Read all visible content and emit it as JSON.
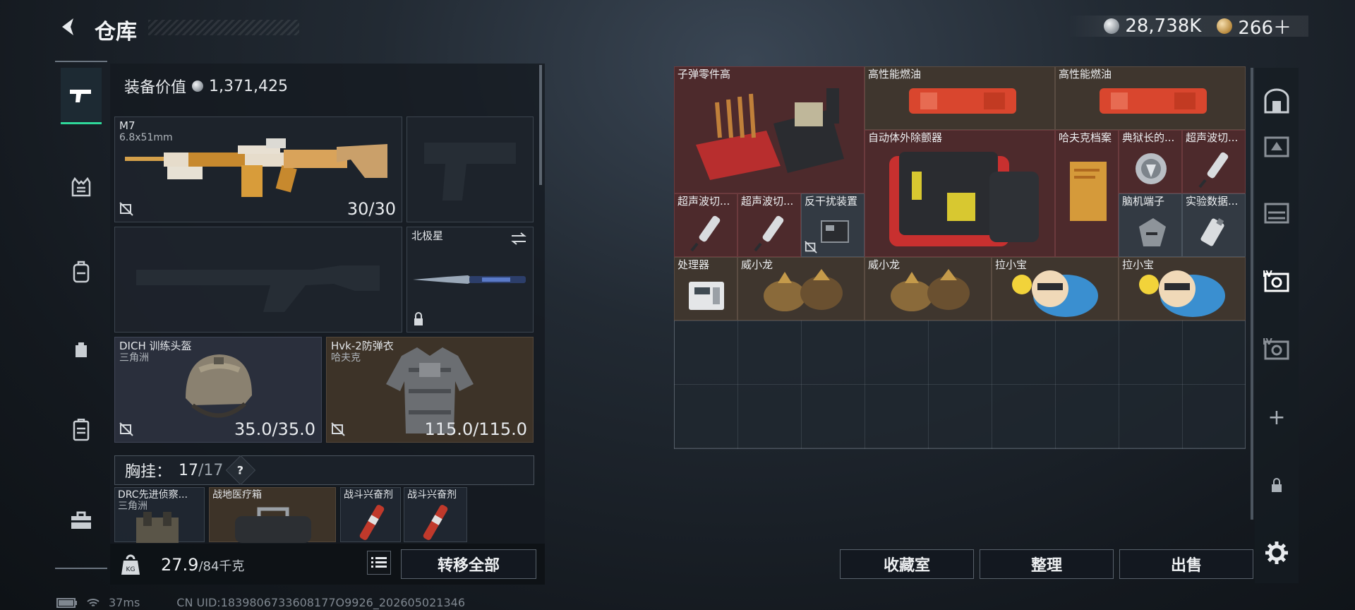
{
  "header": {
    "title": "仓库",
    "silver_amount": "28,738K",
    "gold_amount": "266＋"
  },
  "loadout": {
    "equip_value_label": "装备价值",
    "equip_value": "1,371,425",
    "primary": {
      "name": "M7",
      "caliber": "6.8x51mm",
      "ammo": "30/30"
    },
    "melee": {
      "name": "北极星"
    },
    "helmet": {
      "name": "DICH 训练头盔",
      "origin": "三角洲",
      "durability": "35.0/35.0"
    },
    "armor": {
      "name": "Hvk-2防弹衣",
      "origin": "哈夫克",
      "durability": "115.0/115.0"
    },
    "chest_rig": {
      "label": "胸挂：",
      "current": "17",
      "max": "/17",
      "help": "?"
    },
    "rig_items": [
      {
        "name": "DRC先进侦察...",
        "sub": "三角洲"
      },
      {
        "name": "战地医疗箱",
        "sub": ""
      },
      {
        "name": "战斗兴奋剂",
        "sub": ""
      },
      {
        "name": "战斗兴奋剂",
        "sub": ""
      }
    ],
    "weight": "27.9",
    "weight_max": "/84千克",
    "transfer_all": "转移全部"
  },
  "storage": {
    "items": [
      {
        "name": "子弹零件高",
        "color": "red"
      },
      {
        "name": "高性能燃油",
        "color": "tan"
      },
      {
        "name": "高性能燃油",
        "color": "tan"
      },
      {
        "name": "自动体外除颤器",
        "color": "red"
      },
      {
        "name": "哈夫克档案",
        "color": "red"
      },
      {
        "name": "典狱长的...",
        "color": "red"
      },
      {
        "name": "超声波切...",
        "color": "red"
      },
      {
        "name": "超声波切...",
        "color": "red"
      },
      {
        "name": "超声波切...",
        "color": "red"
      },
      {
        "name": "反干扰装置",
        "color": "grey"
      },
      {
        "name": "脑机端子",
        "color": "grey"
      },
      {
        "name": "实验数据...",
        "color": "grey"
      },
      {
        "name": "处理器",
        "color": "tan"
      },
      {
        "name": "威小龙",
        "color": "tan"
      },
      {
        "name": "威小龙",
        "color": "tan"
      },
      {
        "name": "拉小宝",
        "color": "tan"
      },
      {
        "name": "拉小宝",
        "color": "tan"
      }
    ],
    "buttons": {
      "collection": "收藏室",
      "organize": "整理",
      "sell": "出售"
    }
  },
  "status": {
    "ping": "37ms",
    "uid": "CN UID:1839806733608177O9926_202605021346"
  },
  "colors": {
    "accent_green": "#2fd89a",
    "rare_red": "#4d2a2c",
    "common_tan": "#3f362e"
  }
}
